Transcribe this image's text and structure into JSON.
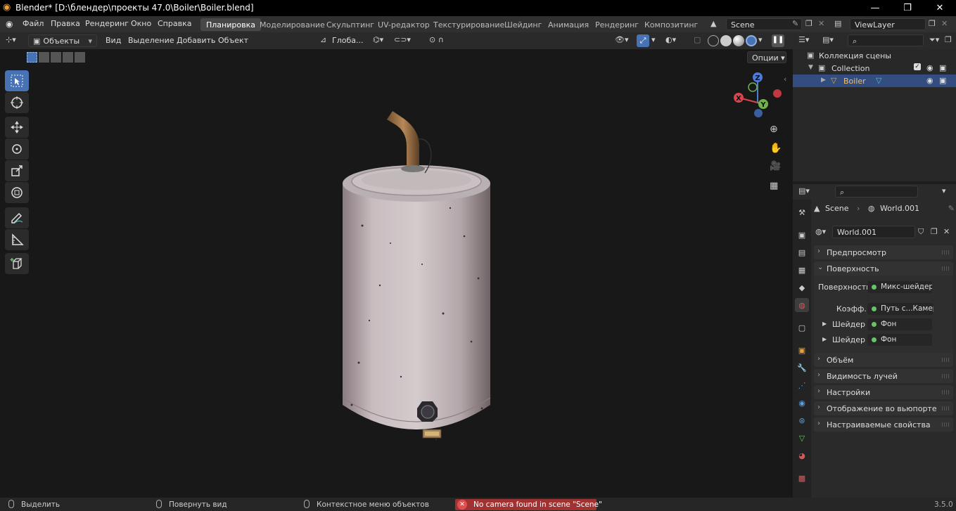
{
  "titlebar": {
    "title": "Blender* [D:\\блендер\\проекты 47.0\\Boiler\\Boiler.blend]"
  },
  "menus": [
    "Файл",
    "Правка",
    "Рендеринг",
    "Окно",
    "Справка"
  ],
  "workspaces": [
    "Планировка",
    "Моделирование",
    "Скульптинг",
    "UV-редактор",
    "Текстурирование",
    "Шейдинг",
    "Анимация",
    "Рендеринг",
    "Композитинг"
  ],
  "scene": {
    "name": "Scene",
    "view_layer": "ViewLayer"
  },
  "viewport": {
    "mode": "Объекты",
    "menus": [
      "Вид",
      "Выделение",
      "Добавить",
      "Объект"
    ],
    "transform_orientation": "Глоба...",
    "options_label": "Опции",
    "gizmo": {
      "z": "Z",
      "y": "Y",
      "x": "X"
    }
  },
  "outliner": {
    "scene_collection": "Коллекция сцены",
    "collection": "Collection",
    "object": "Boiler"
  },
  "properties": {
    "breadcrumb_scene": "Scene",
    "breadcrumb_world": "World.001",
    "world_name": "World.001",
    "panels_top": [
      "Предпросмотр"
    ],
    "surface_panel": "Поверхность",
    "surface_label": "Поверхность",
    "surface_value": "Микс-шейдер",
    "fac_label": "Коэфф.",
    "fac_value": "Путь с...Камеры",
    "shader1_label": "Шейдер",
    "shader1_value": "Фон",
    "shader2_label": "Шейдер",
    "shader2_value": "Фон",
    "panels_bottom": [
      "Объём",
      "Видимость лучей",
      "Настройки",
      "Отображение во вьюпорте",
      "Настраиваемые свойства"
    ]
  },
  "statusbar": {
    "select": "Выделить",
    "rotate": "Повернуть вид",
    "context": "Контекстное меню объектов",
    "error": "No camera found in scene \"Scene\"",
    "version": "3.5.0"
  },
  "colors": {
    "accent": "#4772b3",
    "error": "#a03232",
    "selected_row": "#334d80"
  }
}
